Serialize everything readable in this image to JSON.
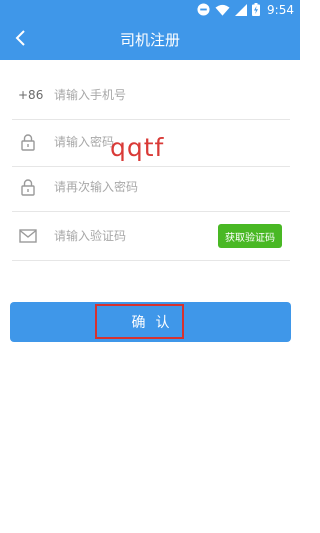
{
  "status_bar": {
    "time": "9:54",
    "icons": [
      "do-not-disturb-icon",
      "wifi-icon",
      "signal-icon",
      "battery-icon"
    ]
  },
  "app_bar": {
    "title": "司机注册",
    "back_icon": "chevron-left-icon"
  },
  "form": {
    "phone": {
      "country_code": "+86",
      "placeholder": "请输入手机号",
      "value": ""
    },
    "password": {
      "icon": "lock-icon",
      "placeholder": "请输入密码",
      "value": ""
    },
    "confirm_password": {
      "icon": "lock-icon",
      "placeholder": "请再次输入密码",
      "value": ""
    },
    "verify_code": {
      "icon": "mail-icon",
      "placeholder": "请输入验证码",
      "value": "",
      "button_label": "获取验证码"
    }
  },
  "confirm_button": {
    "label": "确认"
  },
  "overlay": {
    "watermark_text": "qqtf"
  },
  "colors": {
    "primary": "#3f97e9",
    "code_button": "#49b824",
    "annotation": "#d6322f",
    "placeholder": "#a8a8a8"
  }
}
